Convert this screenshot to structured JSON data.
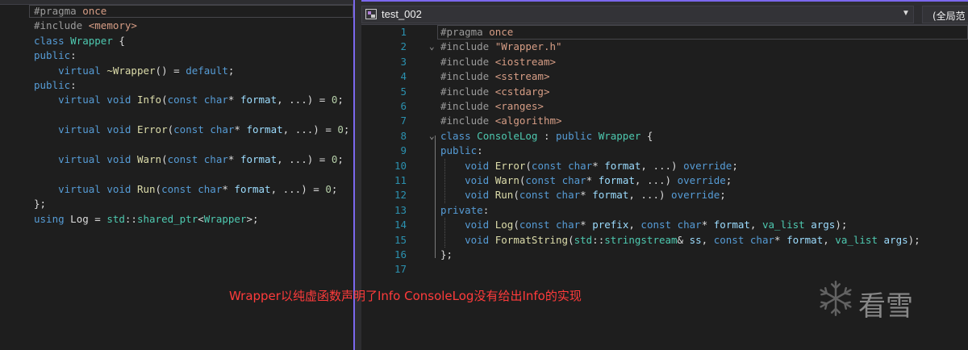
{
  "left_editor": {
    "lines": [
      "#pragma once",
      "#include <memory>",
      "class Wrapper {",
      "public:",
      "    virtual ~Wrapper() = default;",
      "public:",
      "    virtual void Info(const char* format, ...) = 0;",
      "",
      "    virtual void Error(const char* format, ...) = 0;",
      "",
      "    virtual void Warn(const char* format, ...) = 0;",
      "",
      "    virtual void Run(const char* format, ...) = 0;",
      "};",
      "using Log = std::shared_ptr<Wrapper>;"
    ]
  },
  "right_editor": {
    "project_name": "test_002",
    "scope_label": "(全局范",
    "line_numbers": [
      "1",
      "2",
      "3",
      "4",
      "5",
      "6",
      "7",
      "8",
      "9",
      "10",
      "11",
      "12",
      "13",
      "14",
      "15",
      "16",
      "17"
    ],
    "lines": [
      "#pragma once",
      "#include \"Wrapper.h\"",
      "#include <iostream>",
      "#include <sstream>",
      "#include <cstdarg>",
      "#include <ranges>",
      "#include <algorithm>",
      "class ConsoleLog : public Wrapper {",
      "public:",
      "    void Error(const char* format, ...) override;",
      "    void Warn(const char* format, ...) override;",
      "    void Run(const char* format, ...) override;",
      "private:",
      "    void Log(const char* prefix, const char* format, va_list args);",
      "    void FormatString(std::stringstream& ss, const char* format, va_list args);",
      "};",
      ""
    ]
  },
  "annotation": {
    "caption": "Wrapper以纯虚函数声明了Info ConsoleLog没有给出Info的实现"
  },
  "watermark": {
    "text": "看雪",
    "icon": "snowflake-icon"
  },
  "colors": {
    "background": "#1e1e1e",
    "keyword": "#569cd6",
    "type": "#4ec9b0",
    "function": "#dcdcaa",
    "string": "#d69d85",
    "line_number": "#2b91af",
    "caption": "#ff3b3b",
    "accent": "#7b68ee"
  }
}
